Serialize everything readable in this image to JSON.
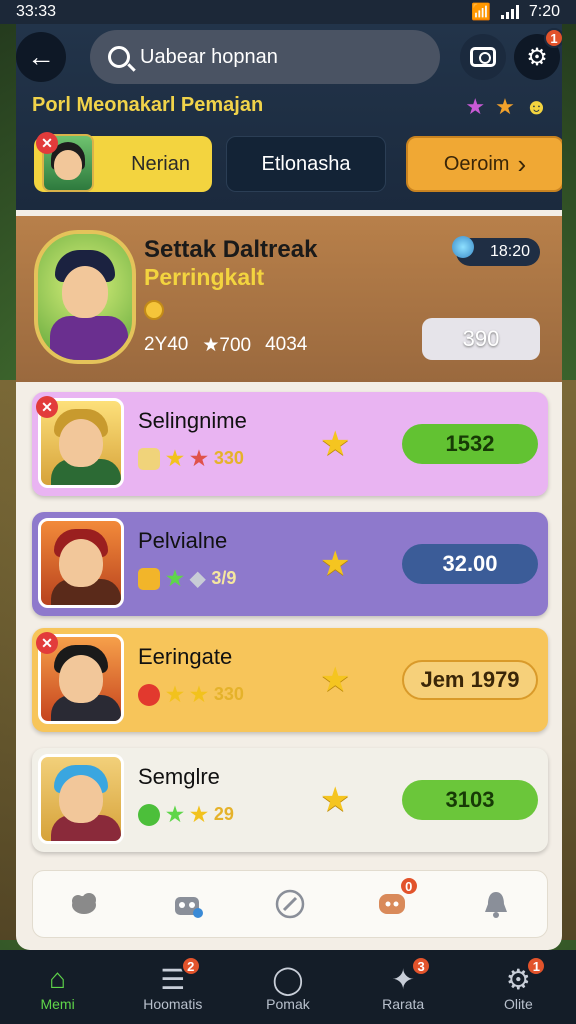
{
  "status_bar": {
    "time_left": "33:33",
    "time_right": "7:20"
  },
  "header": {
    "search_text": "Uabear hopnan",
    "subtitle": "Porl Meonakarl Pemajan",
    "camera_badge": "",
    "settings_badge": "1"
  },
  "chips": [
    {
      "label": "Nerian"
    },
    {
      "label": "Etlonasha"
    },
    {
      "label": "Oeroim",
      "arrow": "›"
    }
  ],
  "featured": {
    "title": "Settak Daltreak",
    "subtitle": "Perringkalt",
    "stats": [
      "2Y40",
      "★700",
      "4034"
    ],
    "timer": "18:20",
    "button_label": "390"
  },
  "cards": [
    {
      "name": "Selingnime",
      "meta": "330",
      "value": "1532",
      "bg": "#e9b4f2",
      "pill_bg": "#62c232",
      "pill_fg": "#173a06"
    },
    {
      "name": "Pelvialne",
      "meta": "3/9",
      "value": "32.00",
      "bg": "#8e79cc",
      "pill_bg": "#3b5c98",
      "pill_fg": "#ffffff"
    },
    {
      "name": "Eeringate",
      "meta": "330",
      "value": "Jem 1979",
      "bg": "#f7c55a",
      "pill_bg": "#f6d07a",
      "pill_fg": "#3a2608"
    },
    {
      "name": "Semglre",
      "meta": "29",
      "value": "3103",
      "bg": "#f2f0e8",
      "pill_bg": "#6bc63a",
      "pill_fg": "#173a06"
    }
  ],
  "minibar": {
    "icons": [
      "cloud-icon",
      "robot-icon",
      "compass-icon",
      "chat-icon",
      "bell-icon"
    ],
    "chat_badge": "0"
  },
  "nav": {
    "items": [
      {
        "label": "Memi",
        "icon": "home-icon",
        "active": true
      },
      {
        "label": "Hoomatis",
        "icon": "list-icon",
        "badge": "2"
      },
      {
        "label": "Pomak",
        "icon": "search-icon"
      },
      {
        "label": "Rarata",
        "icon": "puzzle-icon",
        "badge": "3"
      },
      {
        "label": "Olite",
        "icon": "settings-icon",
        "badge": "1"
      }
    ]
  }
}
